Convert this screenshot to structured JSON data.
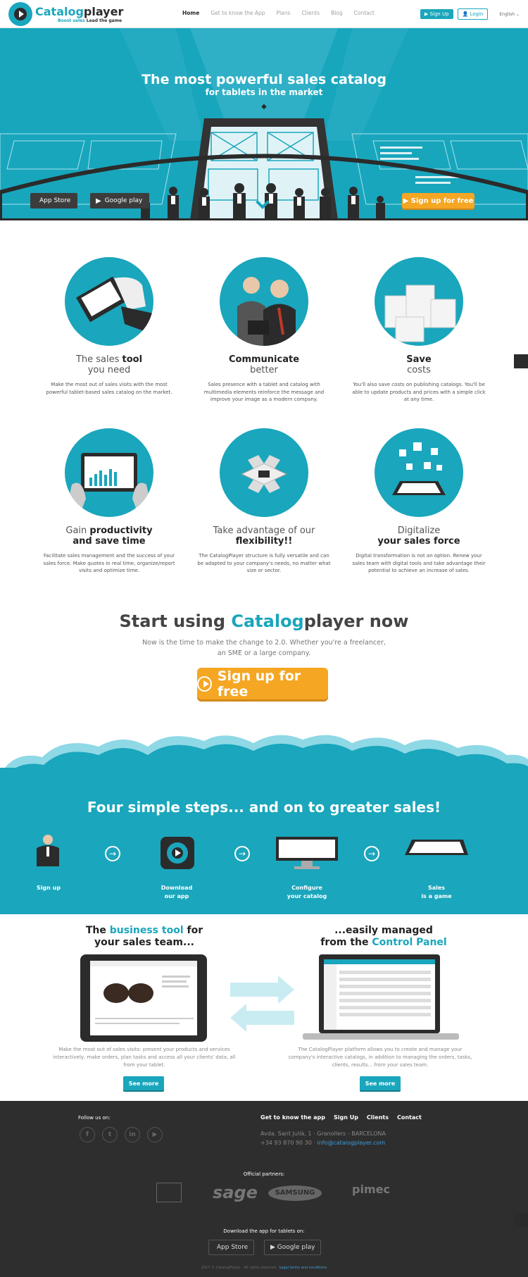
{
  "header": {
    "logo_name_1": "Catalog",
    "logo_name_2": "player",
    "tagline_1": "Boost sales",
    "tagline_2": "Lead the game",
    "nav": [
      "Home",
      "Get to know the App",
      "Plans",
      "Clients",
      "Blog",
      "Contact"
    ],
    "signup": "Sign Up",
    "login": "Login",
    "language": "English"
  },
  "hero": {
    "title": "The most powerful sales catalog",
    "subtitle": "for tablets in the market",
    "app_store": "App Store",
    "google_play": "Google play",
    "signup_free": "Sign up for free"
  },
  "features": [
    {
      "title_a": "The sales ",
      "title_b": "tool",
      "title_c": "you need",
      "desc": "Make the most out of sales visits with the most powerful tablet-based sales catalog on the market."
    },
    {
      "title_a": "",
      "title_b": "Communicate",
      "title_c": "better",
      "desc": "Sales presence with a tablet and catalog with multimedia elements reinforce the message and improve your image as a modern company."
    },
    {
      "title_a": "",
      "title_b": "Save",
      "title_c": "costs",
      "desc": "You'll also save costs on publishing catalogs. You'll be able to update products and prices with a simple click at any time."
    },
    {
      "title_a": "Gain ",
      "title_b": "productivity",
      "title_c": "and save time",
      "desc": "Facilitate sales management and the success of your sales force. Make quotes in real time, organize/report visits and optimize time."
    },
    {
      "title_a": "Take advantage of our",
      "title_b": "",
      "title_c": "flexibility!!",
      "desc": "The CatalogPlayer structure is fully versatile and can be adapted to your company's needs, no matter what size or sector."
    },
    {
      "title_a": "Digitalize",
      "title_b": "",
      "title_c": "your sales force",
      "desc": "Digital transformation is not an option. Renew your sales team with digital tools and take advantage their potential to achieve an increase of sales."
    }
  ],
  "start": {
    "title_a": "Start using ",
    "title_b": "Catalog",
    "title_c": "player now",
    "desc": "Now is the time to make the change to 2.0. Whether you're a freelancer, an SME or a large company.",
    "button": "Sign up for free"
  },
  "steps": {
    "title": "Four simple steps... and on to greater sales!",
    "items": [
      {
        "l1": "Sign up",
        "l2": ""
      },
      {
        "l1": "Download",
        "l2": "our app"
      },
      {
        "l1": "Configure",
        "l2": "your catalog"
      },
      {
        "l1": "Sales",
        "l2": "is a game"
      }
    ]
  },
  "tools": {
    "left_a": "The ",
    "left_b": "business tool",
    "left_c": " for",
    "left_d": "your sales team...",
    "left_desc": "Make the most out of sales visits: present your products and services interactively, make orders, plan tasks and access all your clients' data, all from your tablet.",
    "right_a": "...easily managed",
    "right_b": "from the ",
    "right_c": "Control Panel",
    "right_desc": "The CatalogPlayer platform allows you to create and manage your company's interactive catalogs, in addition to managing the orders, tasks, clients, results... from your sales team.",
    "see_more": "See more"
  },
  "footer": {
    "follow": "Follow us on:",
    "links": [
      "Get to know the app",
      "Sign Up",
      "Clients",
      "Contact"
    ],
    "address": "Avda. Sant Julià, 1 · Granollers - BARCELONA",
    "phone": "+34 93 870 90 30 · ",
    "email": "info@catalogplayer.com",
    "partners_label": "Official partners:",
    "partners": [
      "sage",
      "SAMSUNG",
      "pimec"
    ],
    "download_label": "Download the app for tablets on:",
    "app_store": "App Store",
    "google_play": "Google play",
    "copyright": "2017 © CatalogPlayer · All rights reserved · ",
    "legal": "Legal terms and conditions"
  },
  "colors": {
    "accent": "#1aa6bc",
    "orange": "#f5a623",
    "dark": "#2e2e2e"
  }
}
